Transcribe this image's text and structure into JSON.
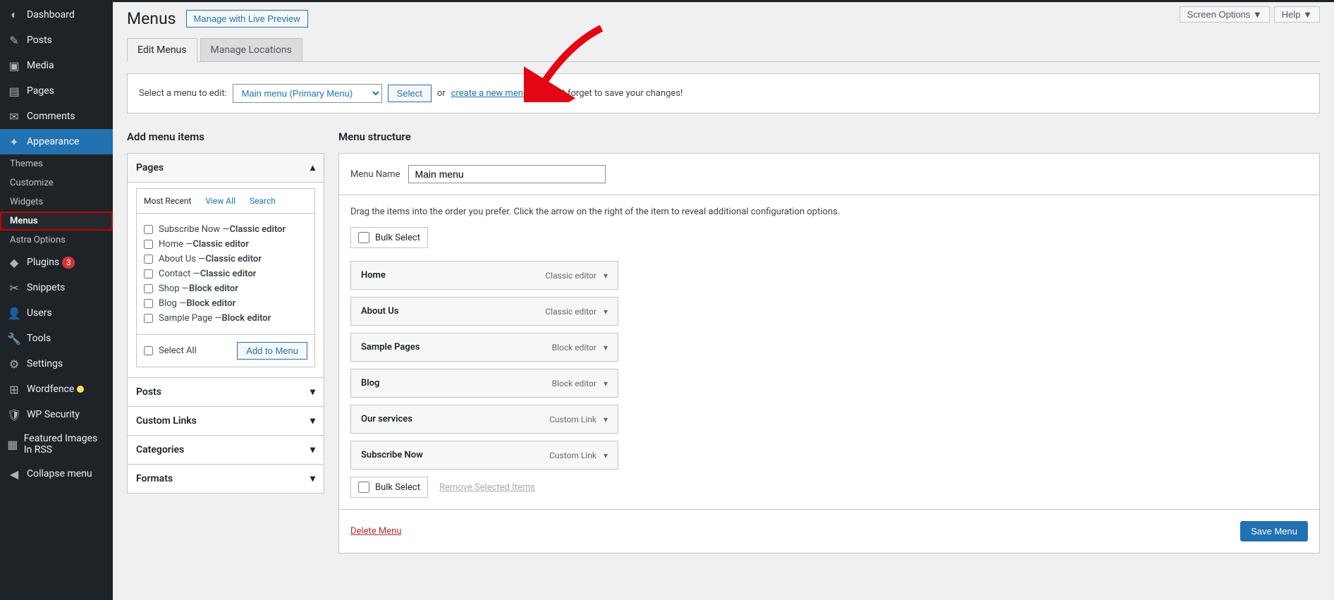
{
  "top": {
    "screenOptions": "Screen Options",
    "help": "Help"
  },
  "header": {
    "title": "Menus",
    "livePreview": "Manage with Live Preview",
    "tabs": [
      "Edit Menus",
      "Manage Locations"
    ]
  },
  "selectBar": {
    "label": "Select a menu to edit:",
    "selected": "Main menu (Primary Menu)",
    "selectBtn": "Select",
    "or": "or ",
    "createLink": "create a new menu",
    "hint": ". Do not forget to save your changes!"
  },
  "left": {
    "title": "Add menu items",
    "acc": [
      "Pages",
      "Posts",
      "Custom Links",
      "Categories",
      "Formats"
    ],
    "innerTabs": [
      "Most Recent",
      "View All",
      "Search"
    ],
    "selectAll": "Select All",
    "addToMenu": "Add to Menu",
    "pages": [
      {
        "name": "Subscribe Now",
        "type": "Classic editor"
      },
      {
        "name": "Home",
        "type": "Classic editor"
      },
      {
        "name": "About Us",
        "type": "Classic editor"
      },
      {
        "name": "Contact",
        "type": "Classic editor"
      },
      {
        "name": "Shop",
        "type": "Block editor"
      },
      {
        "name": "Blog",
        "type": "Block editor"
      },
      {
        "name": "Sample Page",
        "type": "Block editor"
      }
    ]
  },
  "right": {
    "title": "Menu structure",
    "menuNameLabel": "Menu Name",
    "menuName": "Main menu",
    "dragHint": "Drag the items into the order you prefer. Click the arrow on the right of the item to reveal additional configuration options.",
    "bulkSelect": "Bulk Select",
    "removeSelected": "Remove Selected Items",
    "deleteMenu": "Delete Menu",
    "saveMenu": "Save Menu",
    "items": [
      {
        "label": "Home",
        "type": "Classic editor"
      },
      {
        "label": "About Us",
        "type": "Classic editor"
      },
      {
        "label": "Sample Pages",
        "type": "Block editor"
      },
      {
        "label": "Blog",
        "type": "Block editor"
      },
      {
        "label": "Our services",
        "type": "Custom Link"
      },
      {
        "label": "Subscribe Now",
        "type": "Custom Link"
      }
    ]
  },
  "sidebar": [
    {
      "label": "Dashboard",
      "icon": "◐",
      "name": "dashboard"
    },
    {
      "label": "Posts",
      "icon": "✎",
      "name": "posts"
    },
    {
      "label": "Media",
      "icon": "▣",
      "name": "media"
    },
    {
      "label": "Pages",
      "icon": "▤",
      "name": "pages"
    },
    {
      "label": "Comments",
      "icon": "✉",
      "name": "comments"
    },
    {
      "label": "Appearance",
      "icon": "✦",
      "name": "appearance",
      "active": true,
      "sub": [
        {
          "label": "Themes",
          "name": "themes"
        },
        {
          "label": "Customize",
          "name": "customize"
        },
        {
          "label": "Widgets",
          "name": "widgets"
        },
        {
          "label": "Menus",
          "name": "menus",
          "selected": true
        },
        {
          "label": "Astra Options",
          "name": "astra-options"
        }
      ]
    },
    {
      "label": "Plugins",
      "icon": "◆",
      "name": "plugins",
      "badge": "3"
    },
    {
      "label": "Snippets",
      "icon": "✂",
      "name": "snippets"
    },
    {
      "label": "Users",
      "icon": "👤",
      "name": "users"
    },
    {
      "label": "Tools",
      "icon": "🔧",
      "name": "tools"
    },
    {
      "label": "Settings",
      "icon": "⚙",
      "name": "settings"
    },
    {
      "label": "Wordfence",
      "icon": "⊞",
      "name": "wordfence",
      "dot": true
    },
    {
      "label": "WP Security",
      "icon": "🛡",
      "name": "wp-security"
    },
    {
      "label": "Featured Images In RSS",
      "icon": "▦",
      "name": "featured-images-rss"
    },
    {
      "label": "Collapse menu",
      "icon": "◀",
      "name": "collapse-menu"
    }
  ]
}
